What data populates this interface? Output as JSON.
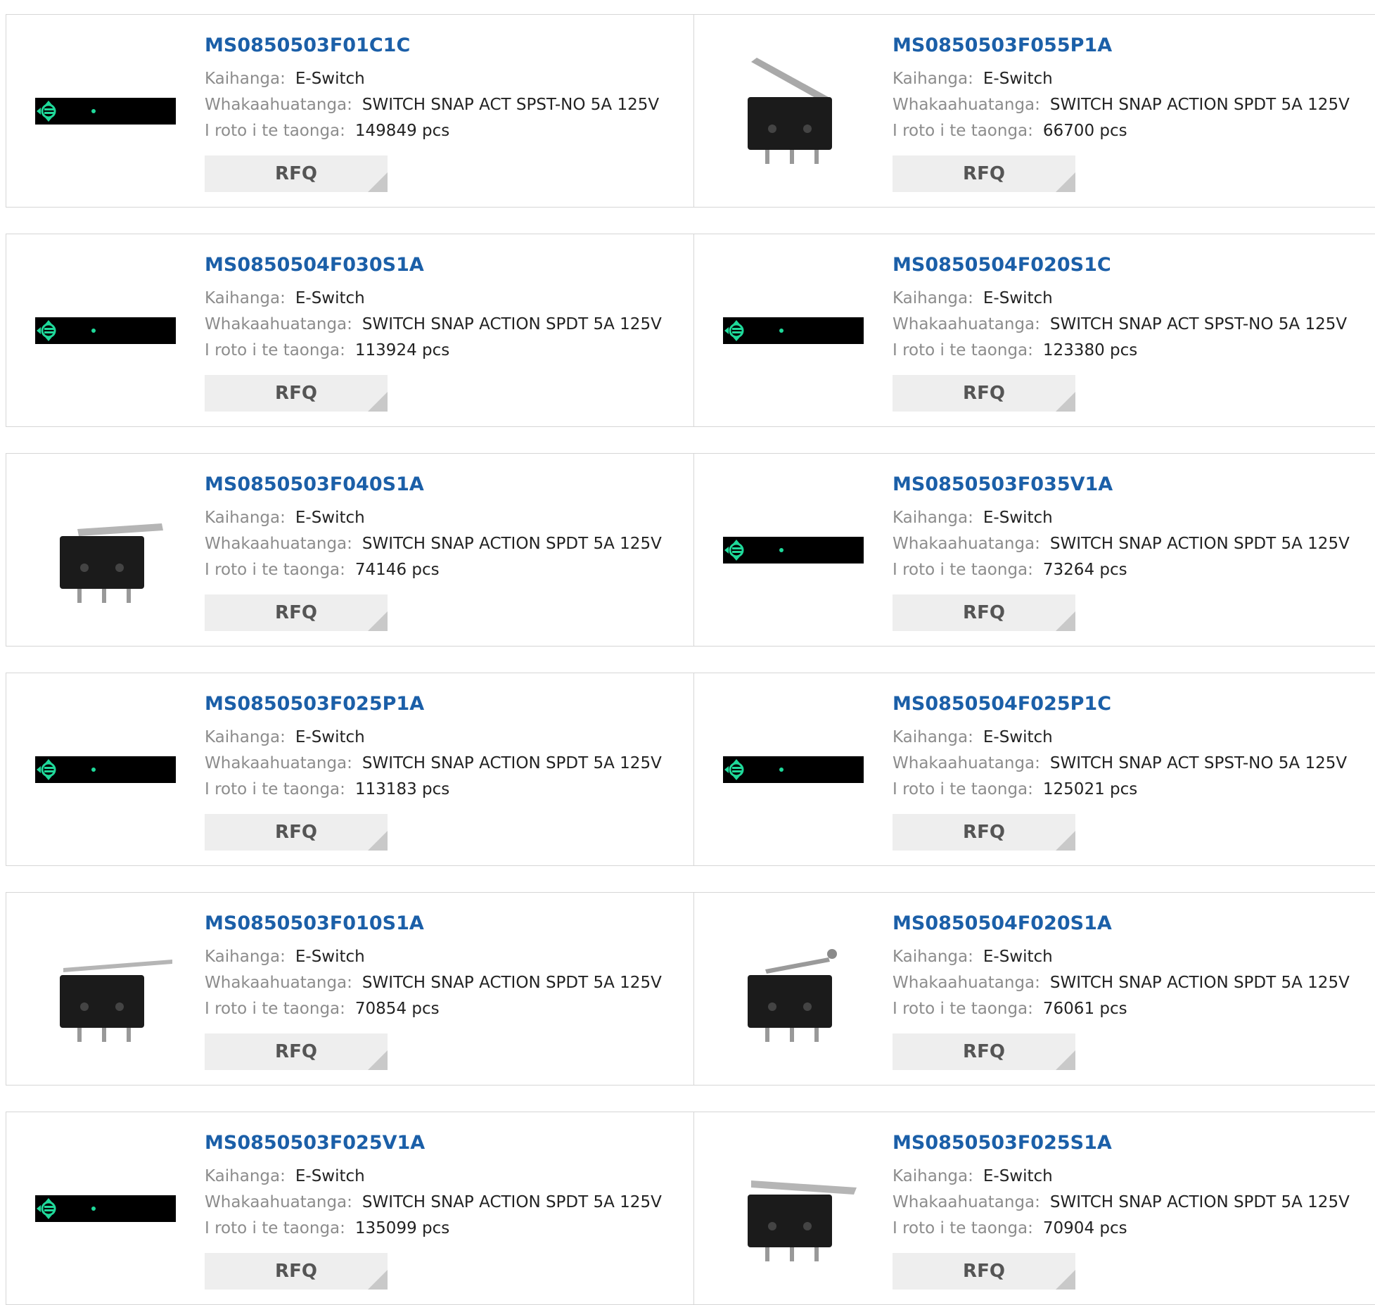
{
  "labels": {
    "manufacturer": "Kaihanga:",
    "description": "Whakaahuatanga:",
    "stock": "I roto i te taonga:",
    "rfq": "RFQ"
  },
  "products": [
    {
      "part": "MS0850503F01C1C",
      "manufacturer": "E-Switch",
      "description": "SWITCH SNAP ACT SPST-NO 5A 125V",
      "stock": "149849 pcs",
      "image": "placeholder"
    },
    {
      "part": "MS0850503F055P1A",
      "manufacturer": "E-Switch",
      "description": "SWITCH SNAP ACTION SPDT 5A 125V",
      "stock": "66700 pcs",
      "image": "switch-long-lever-up"
    },
    {
      "part": "MS0850504F030S1A",
      "manufacturer": "E-Switch",
      "description": "SWITCH SNAP ACTION SPDT 5A 125V",
      "stock": "113924 pcs",
      "image": "placeholder"
    },
    {
      "part": "MS0850504F020S1C",
      "manufacturer": "E-Switch",
      "description": "SWITCH SNAP ACT SPST-NO 5A 125V",
      "stock": "123380 pcs",
      "image": "placeholder"
    },
    {
      "part": "MS0850503F040S1A",
      "manufacturer": "E-Switch",
      "description": "SWITCH SNAP ACTION SPDT 5A 125V",
      "stock": "74146 pcs",
      "image": "switch-angled"
    },
    {
      "part": "MS0850503F035V1A",
      "manufacturer": "E-Switch",
      "description": "SWITCH SNAP ACTION SPDT 5A 125V",
      "stock": "73264 pcs",
      "image": "placeholder"
    },
    {
      "part": "MS0850503F025P1A",
      "manufacturer": "E-Switch",
      "description": "SWITCH SNAP ACTION SPDT 5A 125V",
      "stock": "113183 pcs",
      "image": "placeholder"
    },
    {
      "part": "MS0850504F025P1C",
      "manufacturer": "E-Switch",
      "description": "SWITCH SNAP ACT SPST-NO 5A 125V",
      "stock": "125021 pcs",
      "image": "placeholder"
    },
    {
      "part": "MS0850503F010S1A",
      "manufacturer": "E-Switch",
      "description": "SWITCH SNAP ACTION SPDT 5A 125V",
      "stock": "70854 pcs",
      "image": "switch-flat-lever"
    },
    {
      "part": "MS0850504F020S1A",
      "manufacturer": "E-Switch",
      "description": "SWITCH SNAP ACTION SPDT 5A 125V",
      "stock": "76061 pcs",
      "image": "switch-roller-lever"
    },
    {
      "part": "MS0850503F025V1A",
      "manufacturer": "E-Switch",
      "description": "SWITCH SNAP ACTION SPDT 5A 125V",
      "stock": "135099 pcs",
      "image": "placeholder"
    },
    {
      "part": "MS0850503F025S1A",
      "manufacturer": "E-Switch",
      "description": "SWITCH SNAP ACTION SPDT 5A 125V",
      "stock": "70904 pcs",
      "image": "switch-lever-angled"
    }
  ],
  "colors": {
    "link": "#1b5fa8",
    "label": "#8c8c8c",
    "button_bg": "#eeeeee",
    "border": "#d6d6d6",
    "placeholder_accent": "#1fd99a"
  }
}
